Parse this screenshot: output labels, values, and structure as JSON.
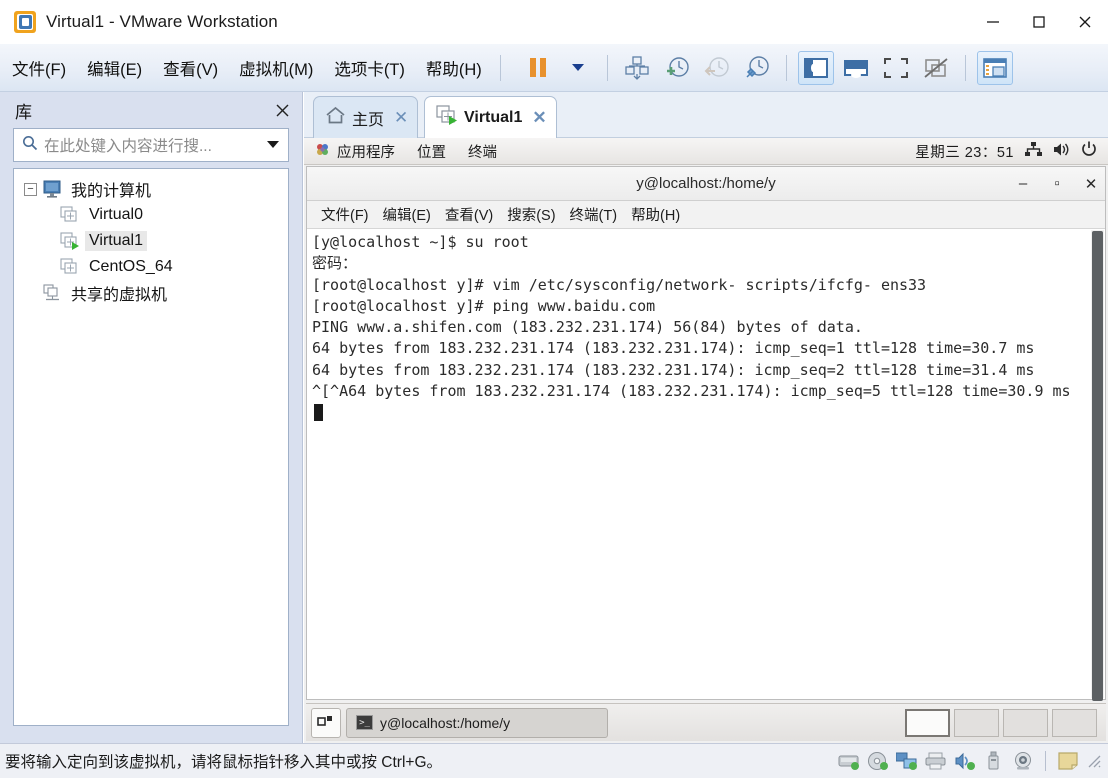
{
  "window": {
    "title": "Virtual1 - VMware Workstation",
    "app_icon": "vmware-icon",
    "controls": {
      "minimize": "—",
      "maximize": "□",
      "close": "✕"
    }
  },
  "menubar": {
    "items": [
      {
        "label": "文件(F)",
        "mnemonic": "F",
        "text": "文件"
      },
      {
        "label": "编辑(E)",
        "mnemonic": "E",
        "text": "编辑"
      },
      {
        "label": "查看(V)",
        "mnemonic": "V",
        "text": "查看"
      },
      {
        "label": "虚拟机(M)",
        "mnemonic": "M",
        "text": "虚拟机"
      },
      {
        "label": "选项卡(T)",
        "mnemonic": "T",
        "text": "选项卡"
      },
      {
        "label": "帮助(H)",
        "mnemonic": "H",
        "text": "帮助"
      }
    ],
    "toolbar": [
      {
        "name": "suspend-button",
        "icon": "pause-icon",
        "active": false
      },
      {
        "name": "power-dropdown-button",
        "icon": "chevron-down-icon",
        "active": false
      },
      {
        "name": "manage-snapshot-button",
        "icon": "snapshot-icon",
        "active": false
      },
      {
        "name": "take-snapshot-button",
        "icon": "snapshot-add-icon",
        "active": false
      },
      {
        "name": "revert-snapshot-button",
        "icon": "snapshot-revert-icon",
        "active": false
      },
      {
        "name": "snapshot-manager-button",
        "icon": "snapshot-manager-icon",
        "active": false
      },
      {
        "name": "show-library-button",
        "icon": "library-panel-icon",
        "active": true
      },
      {
        "name": "show-thumbnail-bar-button",
        "icon": "thumbnail-bar-icon",
        "active": false
      },
      {
        "name": "fullscreen-button",
        "icon": "fullscreen-icon",
        "active": false
      },
      {
        "name": "unity-mode-button",
        "icon": "unity-mode-icon",
        "active": false
      },
      {
        "name": "console-view-button",
        "icon": "console-view-icon",
        "active": true
      }
    ]
  },
  "sidebar": {
    "title": "库",
    "close_label": "✕",
    "search": {
      "placeholder": "在此处键入内容进行搜...",
      "value": "",
      "icon": "search-icon"
    },
    "tree": [
      {
        "label": "我的计算机",
        "level": 0,
        "icon": "monitor-icon",
        "expander": "−",
        "selected": false
      },
      {
        "label": "Virtual0",
        "level": 1,
        "icon": "vm-icon",
        "selected": false
      },
      {
        "label": "Virtual1",
        "level": 1,
        "icon": "vm-running-icon",
        "selected": true
      },
      {
        "label": "CentOS_64",
        "level": 1,
        "icon": "vm-icon",
        "selected": false
      },
      {
        "label": "共享的虚拟机",
        "level": 0,
        "icon": "shared-vm-icon",
        "selected": false
      }
    ]
  },
  "tabs": [
    {
      "label": "主页",
      "icon": "home-icon",
      "active": false,
      "close": "✕"
    },
    {
      "label": "Virtual1",
      "icon": "vm-running-icon",
      "active": true,
      "close": "✕"
    }
  ],
  "gnome_panel": {
    "items": [
      {
        "label": "应用程序",
        "icon": "gnome-foot-icon"
      },
      {
        "label": "位置",
        "icon": ""
      },
      {
        "label": "终端",
        "icon": ""
      }
    ],
    "clock": "星期三 23：51",
    "tray": [
      {
        "name": "network-icon"
      },
      {
        "name": "volume-icon"
      },
      {
        "name": "power-icon"
      }
    ]
  },
  "terminal": {
    "title": "y@localhost:/home/y",
    "controls": {
      "minimize": "–",
      "maximize": "▫",
      "close": "✕"
    },
    "menu": [
      "文件(F)",
      "编辑(E)",
      "查看(V)",
      "搜索(S)",
      "终端(T)",
      "帮助(H)"
    ],
    "lines": [
      "[y@localhost ~]$ su root",
      "密码：",
      "[root@localhost y]# vim /etc/sysconfig/network- scripts/ifcfg- ens33",
      "[root@localhost y]# ping www.baidu.com",
      "PING www.a.shifen.com (183.232.231.174) 56(84) bytes of data.",
      "64 bytes from 183.232.231.174 (183.232.231.174): icmp_seq=1 ttl=128 time=30.7 ms",
      "64 bytes from 183.232.231.174 (183.232.231.174): icmp_seq=2 ttl=128 time=31.4 ms",
      "^[^A64 bytes from 183.232.231.174 (183.232.231.174): icmp_seq=5 ttl=128 time=30.9 ms"
    ]
  },
  "gnome_taskbar": {
    "show_desktop": "show-desktop-icon",
    "window_button": {
      "label": "y@localhost:/home/y",
      "icon": "terminal-icon"
    },
    "workspaces": [
      {
        "current": true
      },
      {
        "current": false
      },
      {
        "current": false
      },
      {
        "current": false
      }
    ]
  },
  "statusbar": {
    "message": "要将输入定向到该虚拟机，请将鼠标指针移入其中或按 Ctrl+G。",
    "devices": [
      {
        "name": "harddisk-icon"
      },
      {
        "name": "cdrom-icon"
      },
      {
        "name": "network-adapter-icon"
      },
      {
        "name": "printer-icon"
      },
      {
        "name": "sound-card-icon"
      },
      {
        "name": "usb-controller-icon"
      },
      {
        "name": "webcam-icon"
      },
      {
        "name": "notes-icon"
      }
    ]
  }
}
